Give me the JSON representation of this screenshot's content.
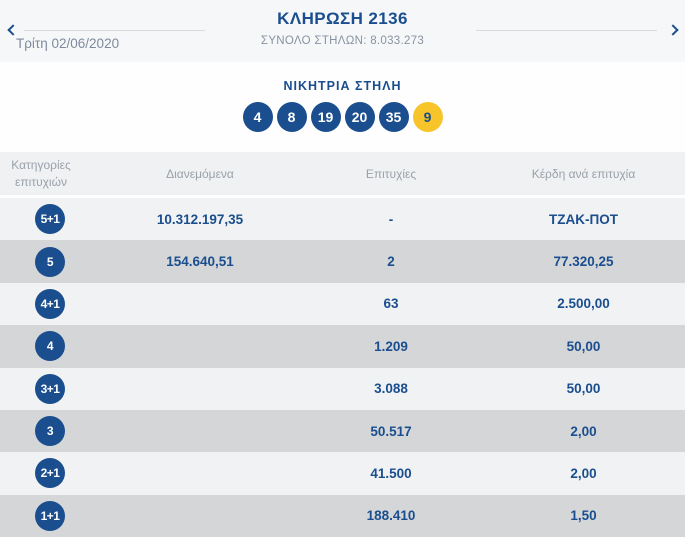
{
  "colors": {
    "brand_blue": "#1a4e8e",
    "joker_yellow": "#f7c52a",
    "top_band_bg": "#f6f7f8",
    "table_header_bg": "#f0f1f2",
    "row_light": "#f1f2f3",
    "row_dark": "#d5d6d8",
    "muted_text": "#99a1ab"
  },
  "nav": {
    "title": "ΚΛΗΡΩΣΗ 2136",
    "total_columns": "ΣΥΝΟΛΟ ΣΤΗΛΩΝ: 8.033.273",
    "date": "Τρίτη 02/06/2020"
  },
  "winning_column": {
    "label": "ΝΙΚΗΤΡΙΑ ΣΤΗΛΗ",
    "numbers": [
      "4",
      "8",
      "19",
      "20",
      "35"
    ],
    "joker_number": "9"
  },
  "table": {
    "headers": {
      "categories_line1": "Κατηγορίες",
      "categories_line2": "επιτυχιών",
      "distributed": "Διανεμόμενα",
      "winners": "Επιτυχίες",
      "prize_per_winner": "Κέρδη ανά επιτυχία"
    },
    "rows": [
      {
        "category": "5+1",
        "distributed": "10.312.197,35",
        "winners": "-",
        "prize": "ΤΖΑΚ-ΠΟΤ"
      },
      {
        "category": "5",
        "distributed": "154.640,51",
        "winners": "2",
        "prize": "77.320,25"
      },
      {
        "category": "4+1",
        "distributed": "",
        "winners": "63",
        "prize": "2.500,00"
      },
      {
        "category": "4",
        "distributed": "",
        "winners": "1.209",
        "prize": "50,00"
      },
      {
        "category": "3+1",
        "distributed": "",
        "winners": "3.088",
        "prize": "50,00"
      },
      {
        "category": "3",
        "distributed": "",
        "winners": "50.517",
        "prize": "2,00"
      },
      {
        "category": "2+1",
        "distributed": "",
        "winners": "41.500",
        "prize": "2,00"
      },
      {
        "category": "1+1",
        "distributed": "",
        "winners": "188.410",
        "prize": "1,50"
      }
    ]
  }
}
